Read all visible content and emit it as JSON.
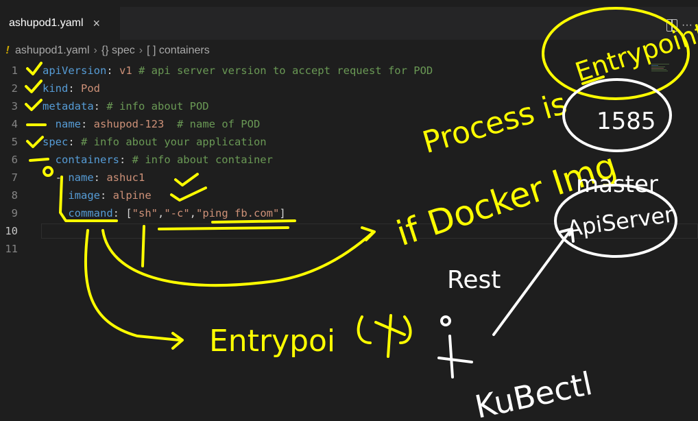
{
  "tab": {
    "filename": "ashupod1.yaml",
    "close_glyph": "×"
  },
  "editor_actions": {
    "more": "···"
  },
  "breadcrumb": {
    "warning": "!",
    "file": "ashupod1.yaml",
    "spec": "{} spec",
    "containers": "[ ] containers"
  },
  "lines": [
    {
      "n": "1",
      "tokens": [
        {
          "t": "apiVersion",
          "c": "key"
        },
        {
          "t": ": ",
          "c": "pun"
        },
        {
          "t": "v1",
          "c": "str"
        },
        {
          "t": " # api server version to accept request for POD",
          "c": "cmt"
        }
      ]
    },
    {
      "n": "2",
      "tokens": [
        {
          "t": "kind",
          "c": "key"
        },
        {
          "t": ": ",
          "c": "pun"
        },
        {
          "t": "Pod",
          "c": "str"
        }
      ]
    },
    {
      "n": "3",
      "tokens": [
        {
          "t": "metadata",
          "c": "key"
        },
        {
          "t": ": ",
          "c": "pun"
        },
        {
          "t": "# info about POD",
          "c": "cmt"
        }
      ]
    },
    {
      "n": "4",
      "tokens": [
        {
          "t": "  name",
          "c": "key"
        },
        {
          "t": ": ",
          "c": "pun"
        },
        {
          "t": "ashupod-123",
          "c": "str"
        },
        {
          "t": "  # name of POD",
          "c": "cmt"
        }
      ]
    },
    {
      "n": "5",
      "tokens": [
        {
          "t": "spec",
          "c": "key"
        },
        {
          "t": ": ",
          "c": "pun"
        },
        {
          "t": "# info about your application",
          "c": "cmt"
        }
      ]
    },
    {
      "n": "6",
      "tokens": [
        {
          "t": "  containers",
          "c": "key"
        },
        {
          "t": ": ",
          "c": "pun"
        },
        {
          "t": "# info about container",
          "c": "cmt"
        }
      ]
    },
    {
      "n": "7",
      "tokens": [
        {
          "t": "  - ",
          "c": "pun"
        },
        {
          "t": "name",
          "c": "key"
        },
        {
          "t": ": ",
          "c": "pun"
        },
        {
          "t": "ashuc1",
          "c": "str"
        }
      ]
    },
    {
      "n": "8",
      "tokens": [
        {
          "t": "    image",
          "c": "key"
        },
        {
          "t": ": ",
          "c": "pun"
        },
        {
          "t": "alpine",
          "c": "str"
        }
      ]
    },
    {
      "n": "9",
      "tokens": [
        {
          "t": "    command",
          "c": "key"
        },
        {
          "t": ": [",
          "c": "pun"
        },
        {
          "t": "\"sh\"",
          "c": "str"
        },
        {
          "t": ",",
          "c": "pun"
        },
        {
          "t": "\"-c\"",
          "c": "str"
        },
        {
          "t": ",",
          "c": "pun"
        },
        {
          "t": "\"ping fb.com\"",
          "c": "str"
        },
        {
          "t": "]",
          "c": "pun"
        }
      ]
    },
    {
      "n": "10",
      "tokens": []
    },
    {
      "n": "11",
      "tokens": []
    }
  ],
  "active_line": "10",
  "annotations": {
    "entrypoint_circle": "Entrypoint",
    "process_is": "Process is",
    "pid": "1585",
    "if_docker": "if Docker Img",
    "master": "master",
    "api_server": "ApiServer",
    "rest": "Rest",
    "kubectl": "KuBectl",
    "entrypoint_bottom": "Entrypoi",
    "yellow": "#ffff00",
    "white": "#ffffff"
  }
}
